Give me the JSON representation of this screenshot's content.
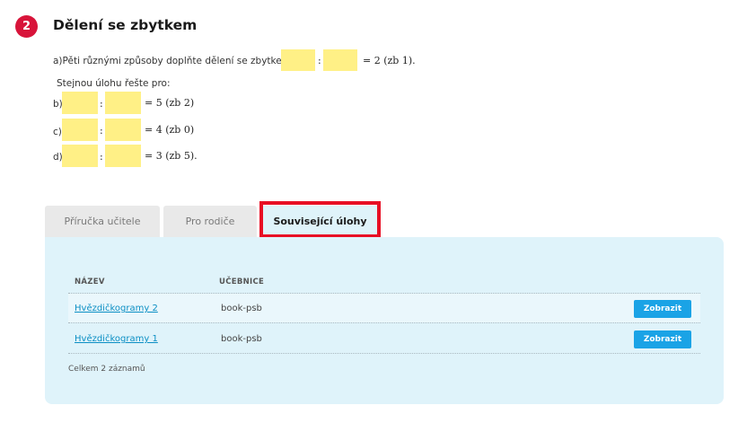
{
  "task": {
    "number": "2",
    "title": "Dělení se zbytkem",
    "line_a_prefix": "a)Pěti různými způsoby doplňte dělení se zbytkem",
    "colon": ":",
    "line_a_suffix": "= 2 (zb 1).",
    "instruction": "Stejnou úlohu řešte pro:",
    "items": [
      {
        "label": "b)",
        "result": "= 5 (zb 2)"
      },
      {
        "label": "c)",
        "result": "= 4 (zb 0)"
      },
      {
        "label": "d)",
        "result": "= 3 (zb 5)."
      }
    ],
    "box_color": "#fff086"
  },
  "tabs": [
    {
      "label": "Příručka učitele",
      "active": false
    },
    {
      "label": "Pro rodiče",
      "active": false
    },
    {
      "label": "Související úlohy",
      "active": true
    }
  ],
  "table": {
    "headers": [
      "NÁZEV",
      "UČEBNICE"
    ],
    "rows": [
      {
        "name": "Hvězdičkogramy 2",
        "book": "book-psb",
        "action": "Zobrazit"
      },
      {
        "name": "Hvězdičkogramy 1",
        "book": "book-psb",
        "action": "Zobrazit"
      }
    ],
    "total": "Celkem 2 záznamů"
  },
  "colors": {
    "badge": "#d8143a",
    "highlight": "#e80f25",
    "panel": "#dff3fa",
    "button": "#1aa3e6",
    "link": "#0b8fc4"
  }
}
